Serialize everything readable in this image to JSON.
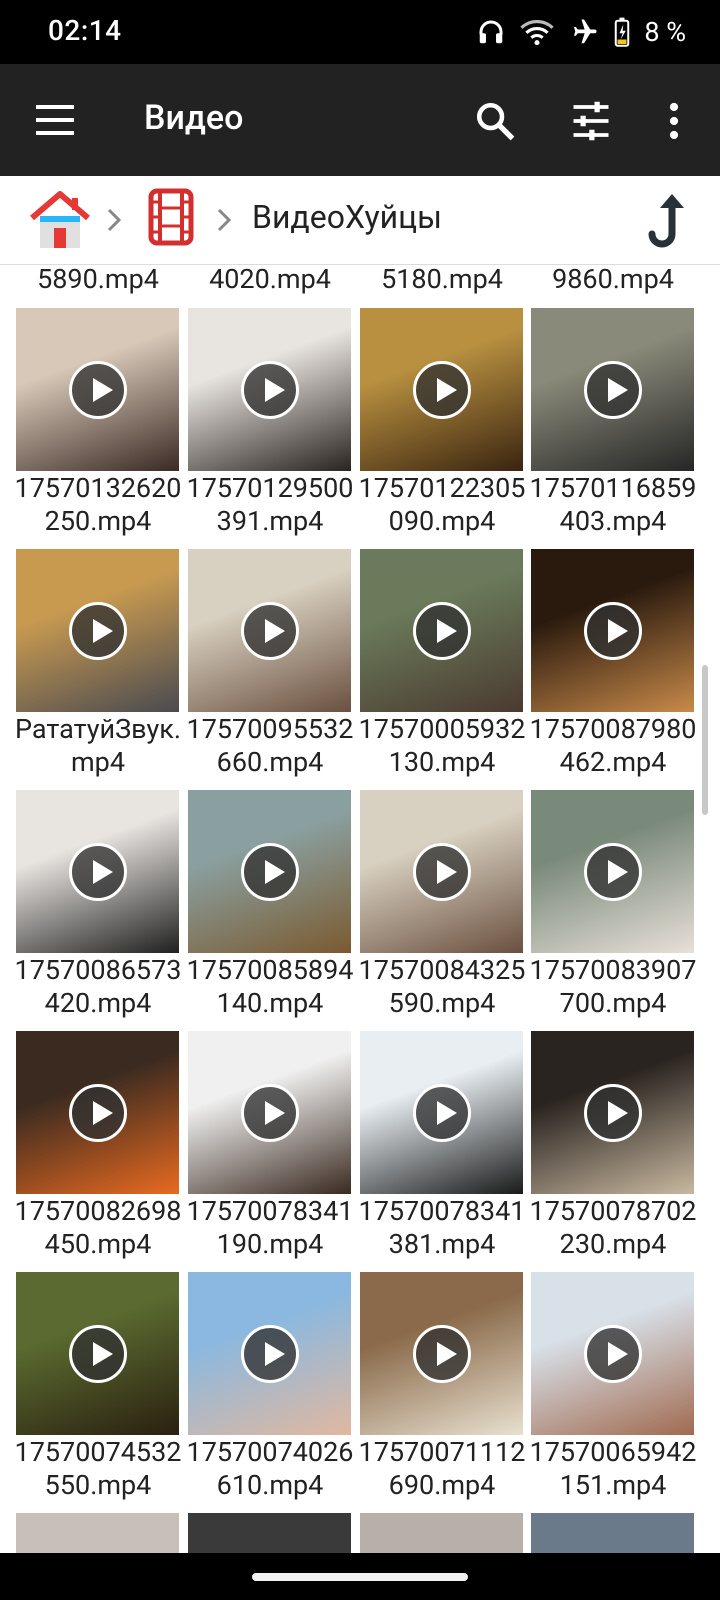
{
  "status_bar": {
    "time": "02:14",
    "battery": "8 %",
    "icons": [
      "headphones-icon",
      "wifi-icon",
      "airplane-mode-icon",
      "battery-charging-icon"
    ]
  },
  "toolbar": {
    "title": "Видео",
    "icons": [
      "menu-icon",
      "search-icon",
      "tune-icon",
      "more-vert-icon"
    ]
  },
  "breadcrumb": {
    "folder": "ВидеоХуйцы",
    "icons": [
      "home-icon",
      "chevron-right-icon",
      "film-icon",
      "chevron-right-icon",
      "up-arrow-icon"
    ]
  },
  "top_partial_row": [
    "5890.mp4",
    "4020.mp4",
    "5180.mp4",
    "9860.mp4"
  ],
  "videos": [
    {
      "name": "17570132620250.mp4",
      "thumb": [
        "#d8c8b8",
        "#3a2a24"
      ]
    },
    {
      "name": "17570129500391.mp4",
      "thumb": [
        "#e8e4e0",
        "#2a2420"
      ]
    },
    {
      "name": "17570122305090.mp4",
      "thumb": [
        "#b89040",
        "#3a2410"
      ]
    },
    {
      "name": "17570116859403.mp4",
      "thumb": [
        "#8a8a7a",
        "#262626"
      ]
    },
    {
      "name": "РататуйЗвук.mp4",
      "thumb": [
        "#c89a50",
        "#4a4a50"
      ]
    },
    {
      "name": "17570095532660.mp4",
      "thumb": [
        "#d8d0c0",
        "#6a5040"
      ]
    },
    {
      "name": "17570005932130.mp4",
      "thumb": [
        "#6a7a5a",
        "#4a3a30"
      ]
    },
    {
      "name": "17570087980462.mp4",
      "thumb": [
        "#2a1a0e",
        "#c88a4a"
      ]
    },
    {
      "name": "17570086573420.mp4",
      "thumb": [
        "#e8e4e0",
        "#202020"
      ]
    },
    {
      "name": "17570085894140.mp4",
      "thumb": [
        "#8aa0a0",
        "#7a5a30"
      ]
    },
    {
      "name": "17570084325590.mp4",
      "thumb": [
        "#d8d0c0",
        "#6a5040"
      ]
    },
    {
      "name": "17570083907700.mp4",
      "thumb": [
        "#7a8a7a",
        "#e8e0d8"
      ]
    },
    {
      "name": "17570082698450.mp4",
      "thumb": [
        "#3a2a20",
        "#e86a20"
      ]
    },
    {
      "name": "17570078341190.mp4",
      "thumb": [
        "#f0f0f0",
        "#3a2a20"
      ]
    },
    {
      "name": "17570078341381.mp4",
      "thumb": [
        "#e8eef2",
        "#1a1a1a"
      ]
    },
    {
      "name": "17570078702230.mp4",
      "thumb": [
        "#2a2420",
        "#c8b8a0"
      ]
    },
    {
      "name": "17570074532550.mp4",
      "thumb": [
        "#5a6a30",
        "#2a2010"
      ]
    },
    {
      "name": "17570074026610.mp4",
      "thumb": [
        "#8ab8e0",
        "#e0b8a0"
      ]
    },
    {
      "name": "17570071112690.mp4",
      "thumb": [
        "#8a6a4a",
        "#e8e0d0"
      ]
    },
    {
      "name": "17570065942151.mp4",
      "thumb": [
        "#d8e0e8",
        "#a06a50"
      ]
    }
  ],
  "bottom_partial_row": [
    {
      "thumb": [
        "#c8c0b8",
        "#c8c0b8"
      ]
    },
    {
      "thumb": [
        "#3a3a3a",
        "#3a3a3a"
      ]
    },
    {
      "thumb": [
        "#b8b0a8",
        "#b8b0a8"
      ]
    },
    {
      "thumb": [
        "#6a7a8a",
        "#6a7a8a"
      ]
    }
  ]
}
